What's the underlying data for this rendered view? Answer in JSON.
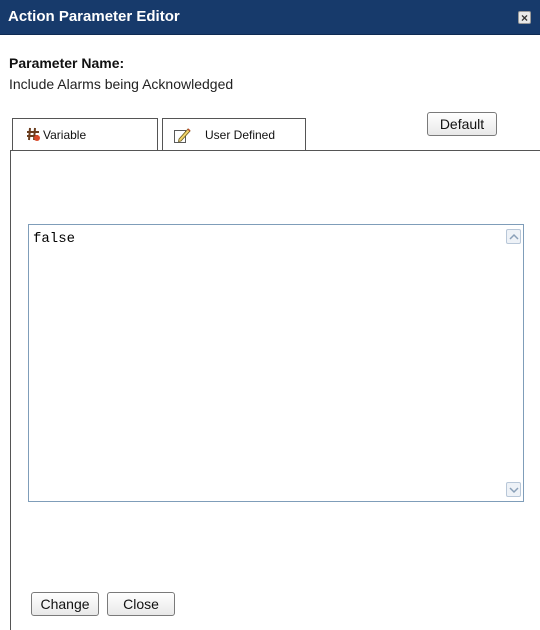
{
  "window": {
    "title": "Action Parameter Editor"
  },
  "parameter": {
    "label": "Parameter Name:",
    "value": "Include Alarms being Acknowledged"
  },
  "tabs": [
    {
      "label": "Variable",
      "icon": "hash-variable-icon",
      "active": false
    },
    {
      "label": "User Defined",
      "icon": "pencil-edit-icon",
      "active": true
    }
  ],
  "toolbar": {
    "default_label": "Default"
  },
  "editor": {
    "value": "false"
  },
  "footer": {
    "change_label": "Change",
    "close_label": "Close"
  },
  "colors": {
    "titlebar": "#173a6b",
    "textarea_border": "#7f9db9"
  }
}
